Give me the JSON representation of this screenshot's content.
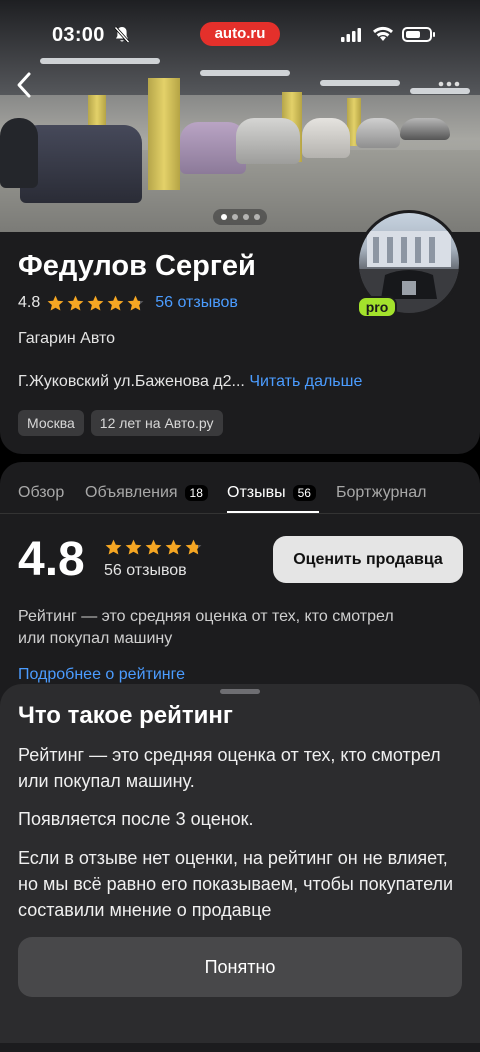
{
  "status_bar": {
    "time": "03:00",
    "brand": "auto.ru"
  },
  "gallery": {
    "pages": 4,
    "current_page": 1
  },
  "seller": {
    "name": "Федулов Сергей",
    "rating": "4.8",
    "rating_stars": 4.8,
    "reviews_link": "56 отзывов",
    "company": "Гагарин Авто",
    "address": "Г.Жуковский ул.Баженова д2...",
    "read_more": "Читать дальше",
    "tags": [
      "Москва",
      "12 лет на Авто.ру"
    ],
    "pro_badge": "pro"
  },
  "tabs": [
    {
      "label": "Обзор",
      "badge": ""
    },
    {
      "label": "Объявления",
      "badge": "18"
    },
    {
      "label": "Отзывы",
      "badge": "56"
    },
    {
      "label": "Бортжурнал",
      "badge": ""
    }
  ],
  "reviews_summary": {
    "rating": "4.8",
    "reviews": "56 отзывов",
    "rate_button": "Оценить продавца",
    "description": "Рейтинг — это средняя оценка от тех, кто смотрел или покупал машину",
    "about_link": "Подробнее о рейтинге"
  },
  "sheet": {
    "title": "Что такое рейтинг",
    "p1": "Рейтинг — это средняя оценка от тех, кто смотрел или покупал машину.",
    "p2": "Появляется после 3 оценок.",
    "p3": "Если в отзыве нет оценки, на рейтинг он не влияет, но мы всё равно его показываем, чтобы покупатели составили мнение о продавце",
    "ok_button": "Понятно"
  },
  "colors": {
    "link": "#4b9cff",
    "star": "#f5a623",
    "brand": "#e4302b",
    "pro": "#a3e22c"
  }
}
